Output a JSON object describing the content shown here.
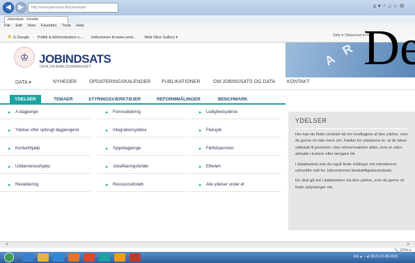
{
  "browser": {
    "address": "http://www.jobindsats.dk/jobindsats/",
    "address_right_icons": "ρ ▾ ♂ ⌂ ☆ ⚙",
    "tab_title": "Jobindsats - Forside",
    "menu": [
      "File",
      "Edit",
      "View",
      "Favorites",
      "Tools",
      "Help"
    ],
    "favorites": [
      "G Google",
      "Politik & Administration o...",
      "Velkommen til www.centr...",
      "Web Slice Gallery ▾"
    ],
    "fav_tools": "Side ▾  Sikkerhed ▾  Pag"
  },
  "site": {
    "logo_title": "JOBINDSATS",
    "logo_subtitle": "DATA OM ARBEJDSMARKEDET",
    "hero_letters": "A R",
    "overlay_text": "De"
  },
  "topnav": [
    "DATA ▾",
    "NYHEDER",
    "OPDATERINGSKALENDER",
    "PUBLIKATIONER",
    "OM JOBINDSATS OG DATA",
    "KONTAKT"
  ],
  "subnav": [
    "YDELSER",
    "TEMAER",
    "STYRINGSVÆRKTØJER",
    "REFORMMÅLINGER",
    "BENCHMARK"
  ],
  "arrow_glyph": "▸",
  "links": {
    "col1": [
      "A-dagpenge",
      "Ydelser efter opbrugt dagpengeret",
      "Kontanthjælp",
      "Uddannelseshjælp",
      "Revalidering"
    ],
    "col2": [
      "Forrevalidering",
      "Integrationsydelse",
      "Sygedagpenge",
      "Jobafklaringsforløb",
      "Ressourceforløb"
    ],
    "col3": [
      "Ledighedsydelse",
      "Fleksjob",
      "Førtidspension",
      "Efterløn",
      "Alle ydelser under ét"
    ]
  },
  "sidebox": {
    "title": "YDELSER",
    "p1": "Her kan du finde centrale tal om modtagere af den ydelse, som du gerne vil vide mere om. Fælles for ydelserne er, at de bliver udbetalt til personer i den erhvervsaktive alder, som er uden arbejde i kortere eller længere tid.",
    "p2": "I databanken kan du også finde målinger om ministerens udmeldte mål for Jobcentrenes beskæftigelsesindsats.",
    "p3": "Du skal gå ind i databanken via den ydelse, som du gerne vil finde oplysninger om."
  },
  "status": {
    "zoom": "🔍 125% ▾",
    "tray": "DA  ▲  ♪ ◂)  09:21\n22-09-2015"
  },
  "taskbar_colors": [
    "#3a7fd0",
    "#e6b43a",
    "#2f8ad6",
    "#e2742a",
    "#d84a2b",
    "#1aa3a0",
    "#f39b1e",
    "#c0392b"
  ]
}
